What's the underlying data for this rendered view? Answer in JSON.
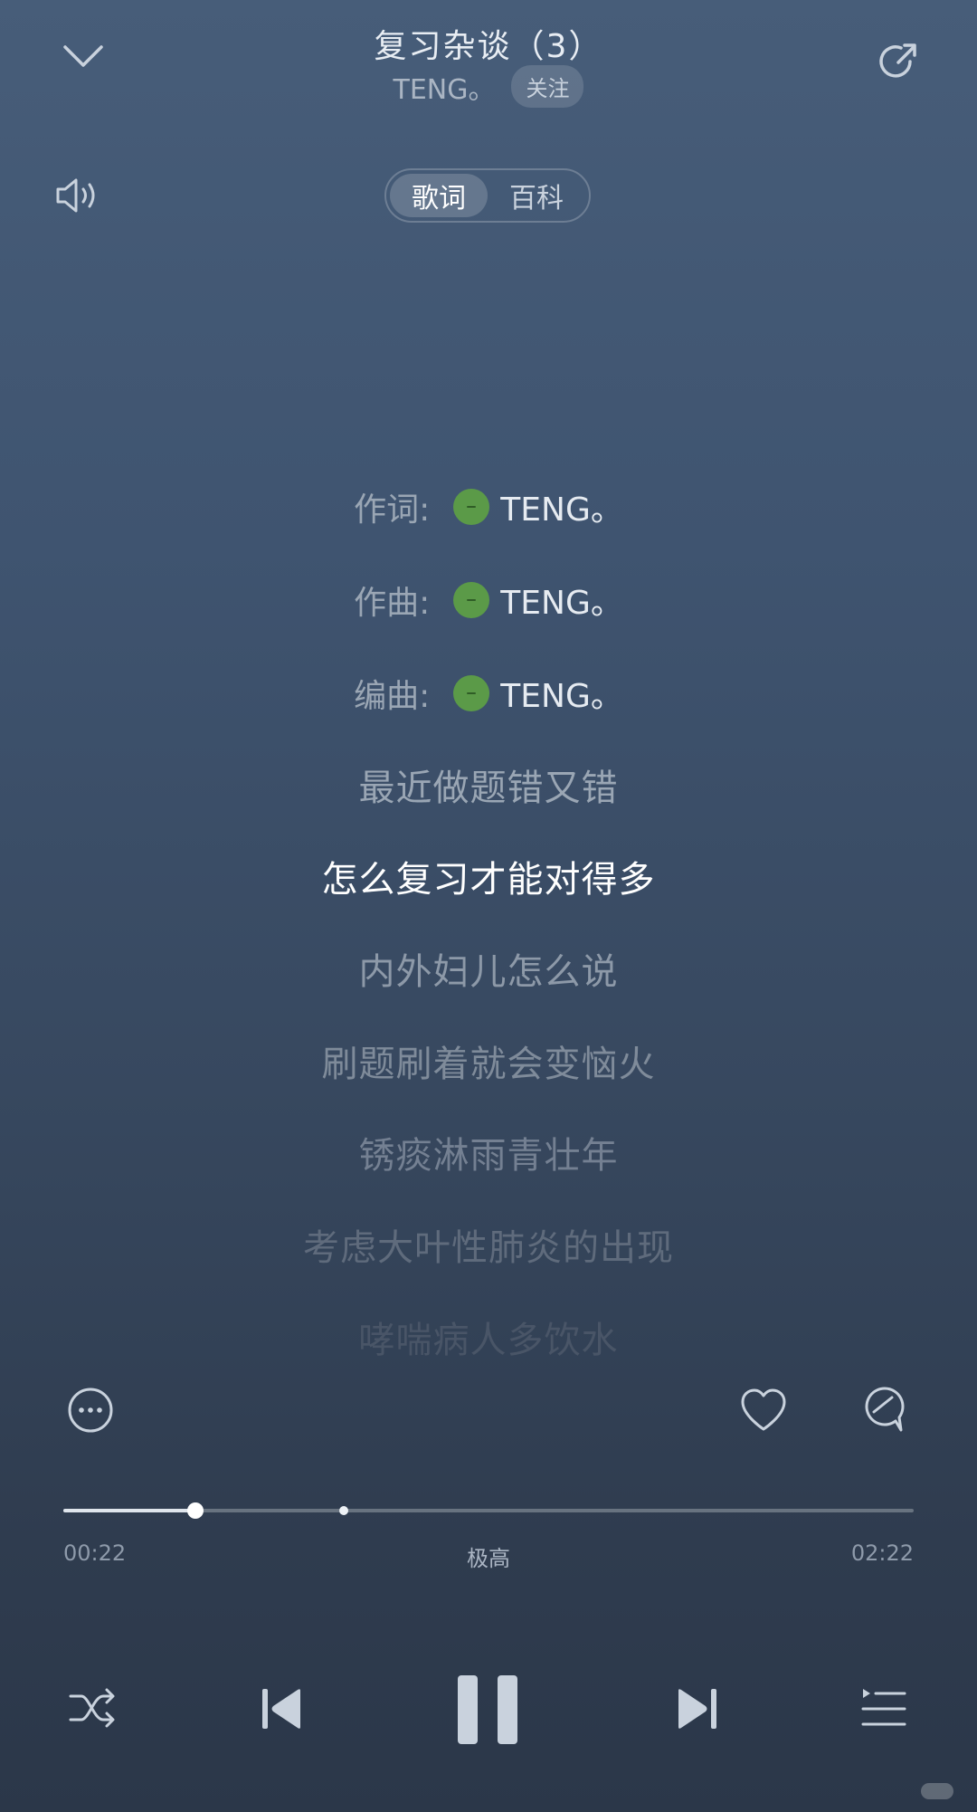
{
  "header": {
    "title": "复习杂谈（3）",
    "artist": "TENG。",
    "follow_label": "关注"
  },
  "tabs": [
    {
      "label": "歌词",
      "active": true
    },
    {
      "label": "百科",
      "active": false
    }
  ],
  "credits": [
    {
      "label": "作词:",
      "name": "TENG。"
    },
    {
      "label": "作曲:",
      "name": "TENG。"
    },
    {
      "label": "编曲:",
      "name": "TENG。"
    }
  ],
  "lyrics": [
    {
      "text": "最近做题错又错",
      "current": false
    },
    {
      "text": "怎么复习才能对得多",
      "current": true
    },
    {
      "text": "内外妇儿怎么说",
      "current": false
    },
    {
      "text": "刷题刷着就会变恼火",
      "current": false
    },
    {
      "text": "锈痰淋雨青壮年",
      "current": false
    },
    {
      "text": "考虑大叶性肺炎的出现",
      "current": false
    },
    {
      "text": "哮喘病人多饮水",
      "current": false
    }
  ],
  "player": {
    "elapsed": "00:22",
    "duration": "02:22",
    "quality": "极高",
    "progress_fraction": 0.155,
    "marker_fraction": 0.33
  },
  "icons": {
    "collapse": "chevron-down-icon",
    "share": "share-icon",
    "volume": "volume-icon",
    "more": "more-icon",
    "like": "heart-icon",
    "comment": "comment-icon",
    "shuffle": "shuffle-icon",
    "previous": "previous-icon",
    "pause": "pause-icon",
    "next": "next-icon",
    "playlist": "playlist-icon"
  },
  "colors": {
    "credit_dot": "#5b9a48",
    "lyric_current": "#ffffff"
  }
}
